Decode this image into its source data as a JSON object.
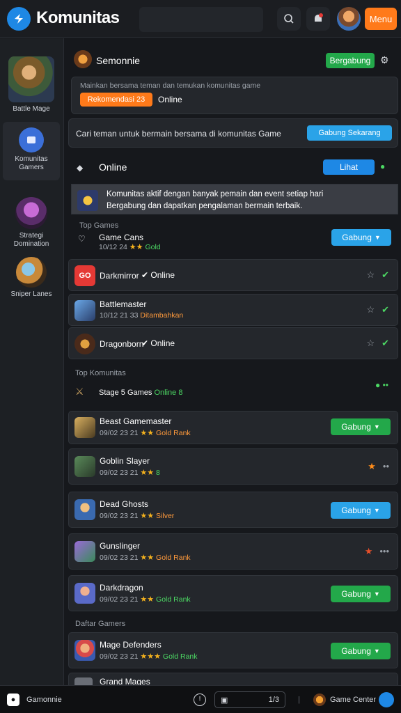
{
  "app": {
    "title": "Komunitas",
    "menu_label": "Menu"
  },
  "sidebar": {
    "items": [
      {
        "label": "Battle Mage"
      },
      {
        "label": "Komunitas Gamers"
      },
      {
        "label": "Strategi Domination"
      },
      {
        "label": "Sniper Lanes"
      }
    ]
  },
  "header": {
    "name": "Semonnie",
    "action": "Bergabung"
  },
  "status_panel": {
    "text": "Mainkan bersama teman dan temukan komunitas game",
    "badge": "Rekomendasi 23",
    "status": "Online"
  },
  "invite_panel": {
    "text": "Cari teman untuk bermain bersama di komunitas Game",
    "action": "Gabung Sekarang"
  },
  "online_section": {
    "title": "Online",
    "action": "Lihat"
  },
  "notice": {
    "line1": "Komunitas aktif dengan banyak pemain dan event setiap hari",
    "line2": "Bergabung dan dapatkan pengalaman bermain terbaik."
  },
  "game_section": {
    "label": "Top Games",
    "title": "Game Cans",
    "meta": "10/12 24",
    "tag": "Gold",
    "action": "Gabung"
  },
  "rows": [
    {
      "title": "Darkmirror",
      "status": "Online",
      "badge": "GO"
    },
    {
      "title": "Battlemaster",
      "meta": "10/12 21 33",
      "status": "Ditambahkan"
    },
    {
      "title": "Dragonborn",
      "status": "Online"
    }
  ],
  "sub_section": {
    "label": "Top Komunitas",
    "title": "Stage 5 Games",
    "status": "Online 8"
  },
  "list": [
    {
      "title": "Beast Gamemaster",
      "meta": "09/02 23 21",
      "tag": "Gold Rank",
      "action": "Gabung"
    },
    {
      "title": "Goblin Slayer",
      "meta": "09/02 23 21",
      "tag": "8"
    },
    {
      "title": "Dead Ghosts",
      "meta": "09/02 23 21",
      "tag": "Silver",
      "action": "Gabung"
    },
    {
      "title": "Gunslinger",
      "meta": "09/02 23 21",
      "tag": "Gold Rank"
    },
    {
      "title": "Darkdragon",
      "meta": "09/02 23 21",
      "tag": "Gold Rank",
      "action": "Gabung"
    }
  ],
  "last_section": {
    "label": "Daftar Gamers"
  },
  "last_row": {
    "title": "Mage Defenders",
    "meta": "09/02 23 21",
    "tag": "Gold Rank",
    "action": "Gabung"
  },
  "partial_row": {
    "title": "Grand Mages"
  },
  "bottom": {
    "left": "Gamonnie",
    "page": "1/3",
    "right": "Game Center"
  },
  "colors": {
    "accent_blue": "#1e88e5",
    "accent_green": "#23a84a",
    "accent_orange": "#ff7a1a"
  }
}
